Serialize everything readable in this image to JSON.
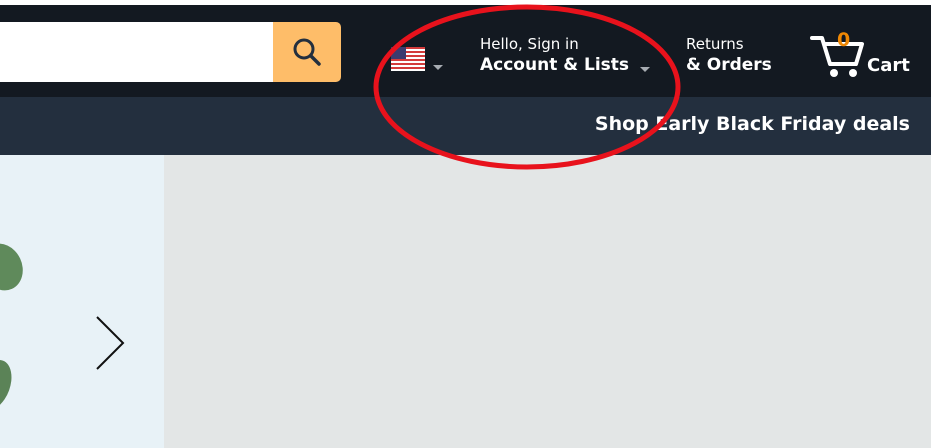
{
  "search": {
    "placeholder": "",
    "value": "",
    "icon": "search-icon"
  },
  "locale": {
    "flag": "us-flag-icon"
  },
  "account": {
    "line1": "Hello, Sign in",
    "line2": "Account & Lists"
  },
  "orders": {
    "line1": "Returns",
    "line2": "& Orders"
  },
  "cart": {
    "count": "0",
    "label": "Cart",
    "icon": "cart-icon"
  },
  "subnav": {
    "deals_link": "Shop Early Black Friday deals"
  },
  "carousel": {
    "next_icon": "chevron-right-icon"
  },
  "colors": {
    "nav_bg": "#131921",
    "subnav_bg": "#232f3e",
    "search_button": "#febd69",
    "cart_count": "#f08804",
    "annotation_circle": "#e8121c"
  }
}
